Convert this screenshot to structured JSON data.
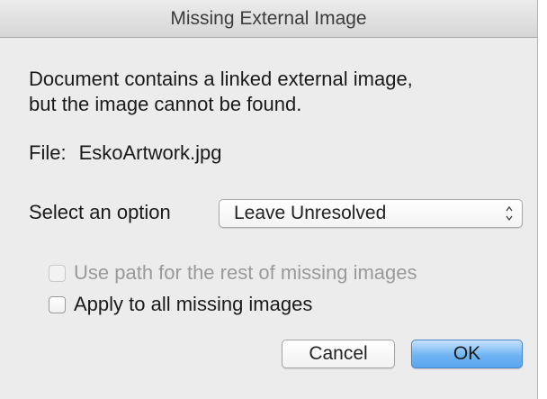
{
  "window": {
    "title": "Missing External Image"
  },
  "message": {
    "line1": "Document contains a linked external image,",
    "line2": "but the image cannot be found."
  },
  "file": {
    "label": "File:",
    "value": "EskoArtwork.jpg"
  },
  "option": {
    "label": "Select an option",
    "selected": "Leave Unresolved"
  },
  "checkboxes": [
    {
      "label": "Use path for the rest of missing images",
      "checked": false,
      "enabled": false
    },
    {
      "label": "Apply to all missing images",
      "checked": false,
      "enabled": true
    }
  ],
  "buttons": {
    "cancel": "Cancel",
    "ok": "OK"
  },
  "colors": {
    "default_button": "#6fb4f4",
    "window_background": "#ececec"
  },
  "icons": {
    "select_arrows": "up-down-chevrons-icon"
  }
}
